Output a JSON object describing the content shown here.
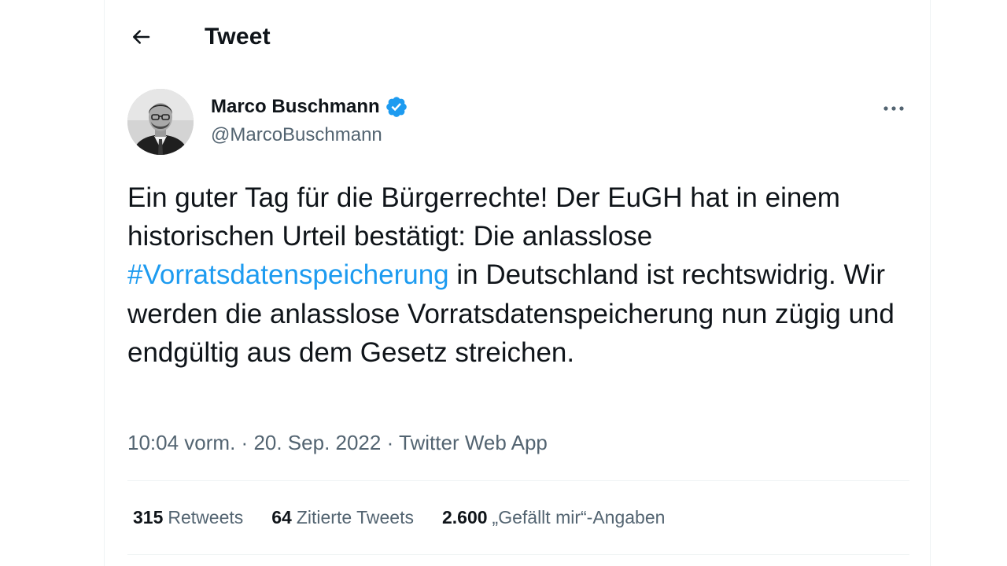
{
  "header": {
    "title": "Tweet",
    "back_icon": "arrow-left-icon"
  },
  "author": {
    "display_name": "Marco Buschmann",
    "handle": "@MarcoBuschmann",
    "verified_icon": "verified-badge-icon",
    "verified_color": "#1d9bf0",
    "more_icon": "more-horizontal-icon"
  },
  "tweet": {
    "text_before": "Ein guter Tag für die Bürgerrechte! Der EuGH hat in einem historischen Urteil bestätigt: Die anlasslose ",
    "hashtag": "#Vorratsdatenspeicherung",
    "text_after": " in Deutschland ist rechtswidrig. Wir werden die anlasslose Vorratsdatenspeicherung nun zügig und endgültig aus dem Gesetz streichen."
  },
  "meta": {
    "time": "10:04 vorm.",
    "separator": "·",
    "date": "20. Sep. 2022",
    "source": "Twitter Web App"
  },
  "stats": {
    "retweets_count": "315",
    "retweets_label": "Retweets",
    "quotes_count": "64",
    "quotes_label": "Zitierte Tweets",
    "likes_count": "2.600",
    "likes_label": "„Gefällt mir“-Angaben"
  },
  "colors": {
    "link": "#1d9bf0",
    "secondary_text": "#536471",
    "primary_text": "#0f1419",
    "divider": "#eff3f4"
  }
}
